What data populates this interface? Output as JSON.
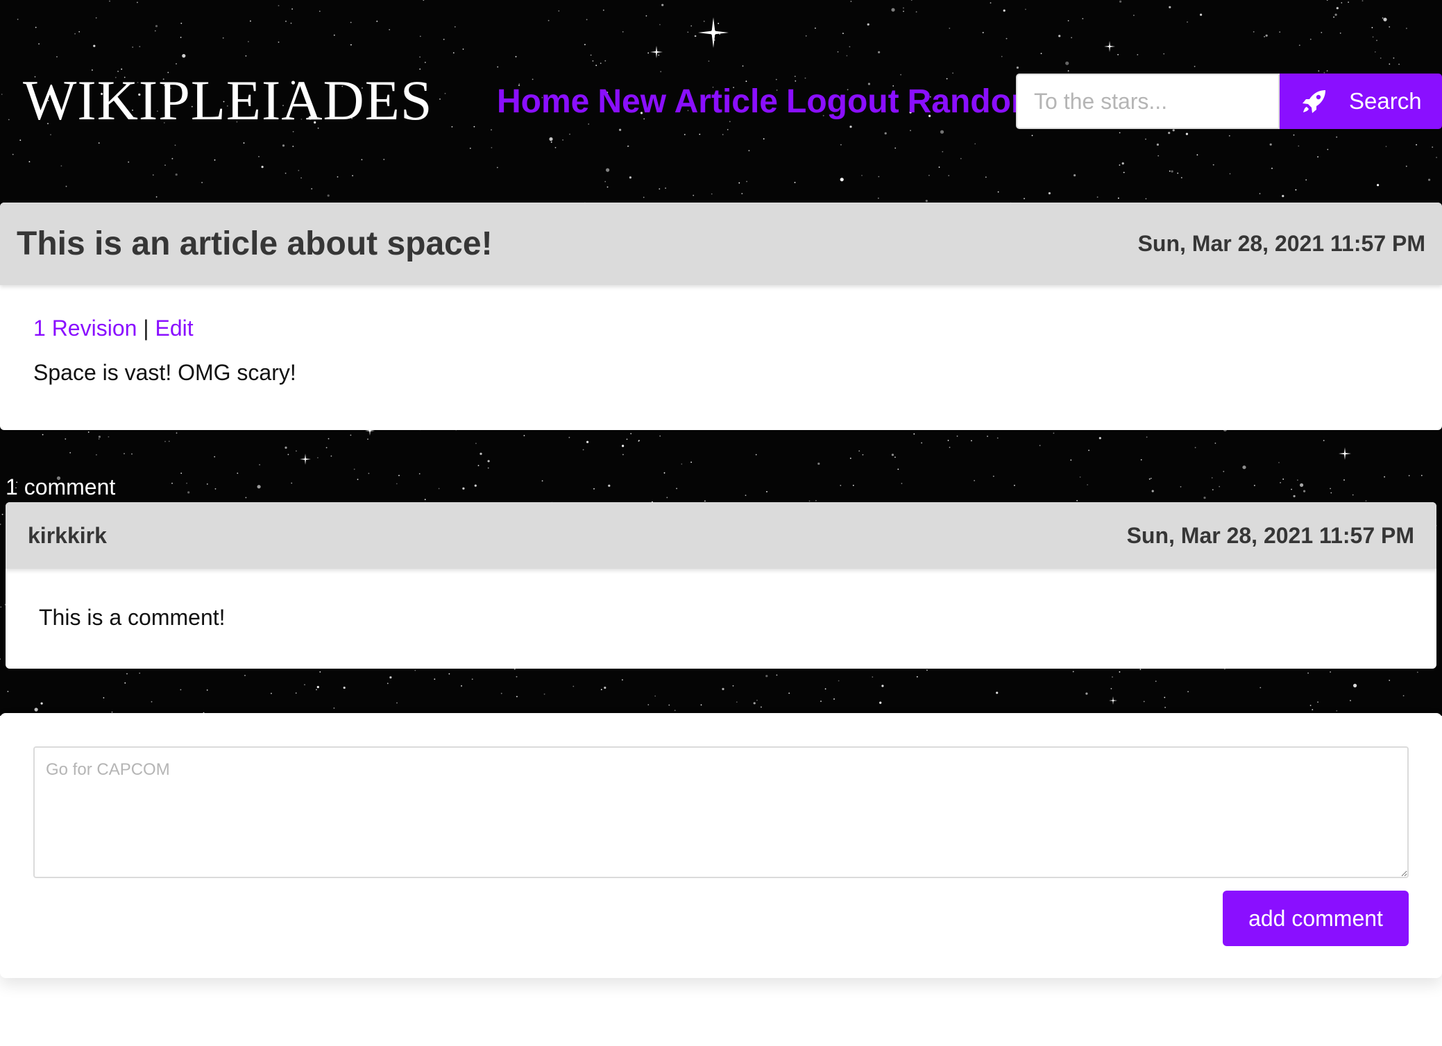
{
  "header": {
    "logo": "WIKIPLEIADES",
    "nav": [
      "Home",
      "New Article",
      "Logout",
      "Random"
    ],
    "search": {
      "placeholder": "To the stars...",
      "value": "",
      "button_label": "Search",
      "button_icon": "rocket-icon"
    }
  },
  "article": {
    "title": "This is an article about space!",
    "date": "Sun, Mar 28, 2021 11:57 PM",
    "revisions_link": "1 Revision",
    "separator": "|",
    "edit_link": "Edit",
    "body": "Space is vast! OMG scary!"
  },
  "comments": {
    "count_label": "1 comment",
    "items": [
      {
        "author": "kirkkirk",
        "date": "Sun, Mar 28, 2021 11:57 PM",
        "text": "This is a comment!"
      }
    ]
  },
  "comment_form": {
    "placeholder": "Go for CAPCOM",
    "value": "",
    "submit_label": "add comment"
  },
  "colors": {
    "accent": "#8a0fff",
    "card_header": "#dbdbdb",
    "background": "#050505"
  }
}
